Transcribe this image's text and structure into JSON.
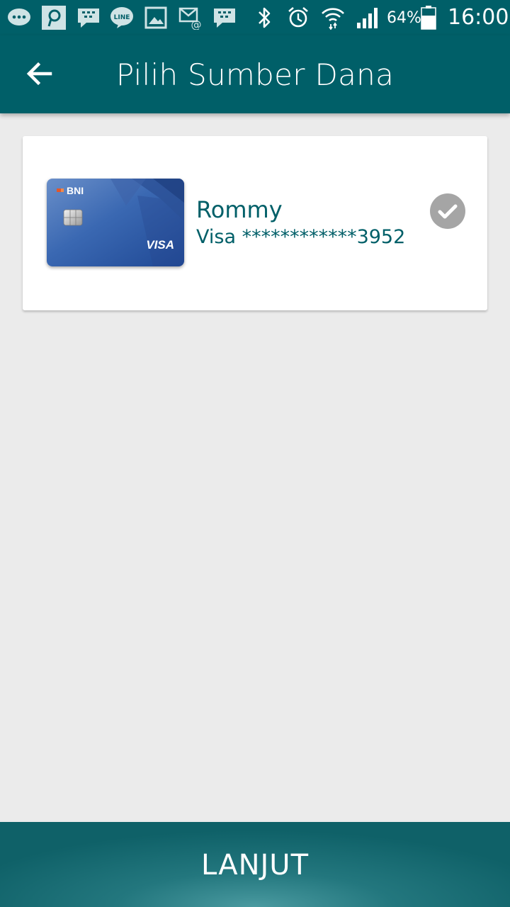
{
  "status_bar": {
    "notification_icons": [
      "chat-bubble-icon",
      "p-app-icon",
      "bbm-icon",
      "line-icon",
      "image-icon",
      "email-icon",
      "bbm-icon"
    ],
    "system_icons": [
      "bluetooth-icon",
      "alarm-icon",
      "wifi-icon",
      "signal-icon",
      "battery-icon"
    ],
    "battery": "64%",
    "time": "16:00"
  },
  "header": {
    "title": "Pilih Sumber Dana",
    "back_icon": "arrow-left-icon"
  },
  "funding_source": {
    "holder_name": "Rommy",
    "card_label": "Visa ************3952",
    "card_bank": "BNI",
    "card_network": "VISA",
    "selected": true,
    "check_icon": "check-circle-icon"
  },
  "footer": {
    "next_label": "LANJUT"
  },
  "colors": {
    "primary": "#005f68",
    "background": "#ebebeb",
    "check": "#a5a5a5"
  }
}
